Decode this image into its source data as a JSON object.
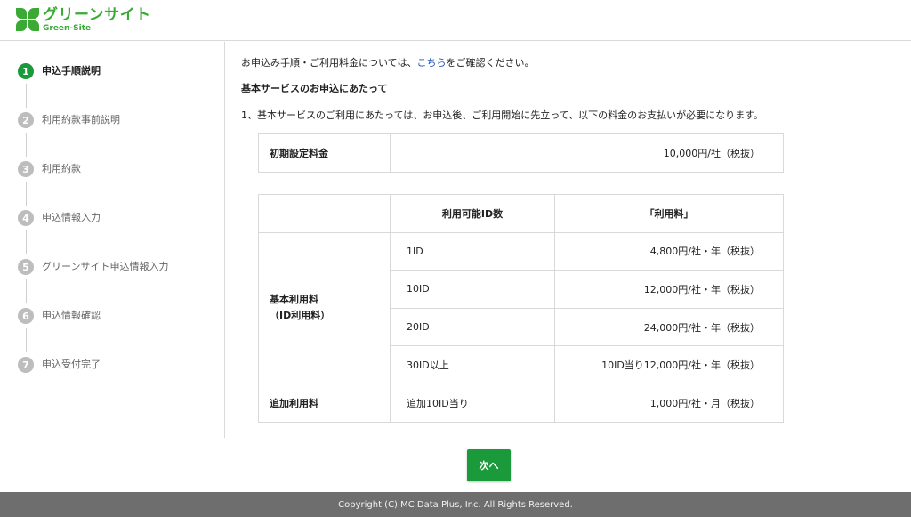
{
  "header": {
    "logo_jp": "グリーンサイト",
    "logo_en": "Green-Site"
  },
  "sidebar": {
    "steps": [
      {
        "num": "1",
        "label": "申込手順説明",
        "active": true
      },
      {
        "num": "2",
        "label": "利用約款事前説明"
      },
      {
        "num": "3",
        "label": "利用約款"
      },
      {
        "num": "4",
        "label": "申込情報入力"
      },
      {
        "num": "5",
        "label": "グリーンサイト申込情報入力"
      },
      {
        "num": "6",
        "label": "申込情報確認"
      },
      {
        "num": "7",
        "label": "申込受付完了"
      }
    ]
  },
  "main": {
    "intro_before": "お申込み手順・ご利用料金については、",
    "intro_link": "こちら",
    "intro_after": "をご確認ください。",
    "section_title": "基本サービスのお申込にあたって",
    "note": "1、基本サービスのご利用にあたっては、お申込後、ご利用開始に先立って、以下の料金のお支払いが必要になります。",
    "initial_fee": {
      "label": "初期設定料金",
      "value": "10,000円/社（税抜）"
    },
    "fee_table": {
      "headers": [
        "",
        "利用可能ID数",
        "「利用料」"
      ],
      "base_label_1": "基本利用料",
      "base_label_2": "（ID利用料）",
      "rows": [
        {
          "ids": "1ID",
          "fee": "4,800円/社・年（税抜）"
        },
        {
          "ids": "10ID",
          "fee": "12,000円/社・年（税抜）"
        },
        {
          "ids": "20ID",
          "fee": "24,000円/社・年（税抜）"
        },
        {
          "ids": "30ID以上",
          "fee": "10ID当り12,000円/社・年（税抜）"
        }
      ],
      "extra": {
        "label": "追加利用料",
        "ids": "追加10ID当り",
        "fee": "1,000円/社・月（税抜）"
      }
    },
    "next_button": "次へ"
  },
  "footer": {
    "copyright": "Copyright (C) MC Data Plus, Inc. All Rights Reserved."
  },
  "colors": {
    "brand_green": "#3aaa35",
    "active_step": "#1a9a3a",
    "link": "#2156b8",
    "footer_bg": "#6e6e6e"
  }
}
